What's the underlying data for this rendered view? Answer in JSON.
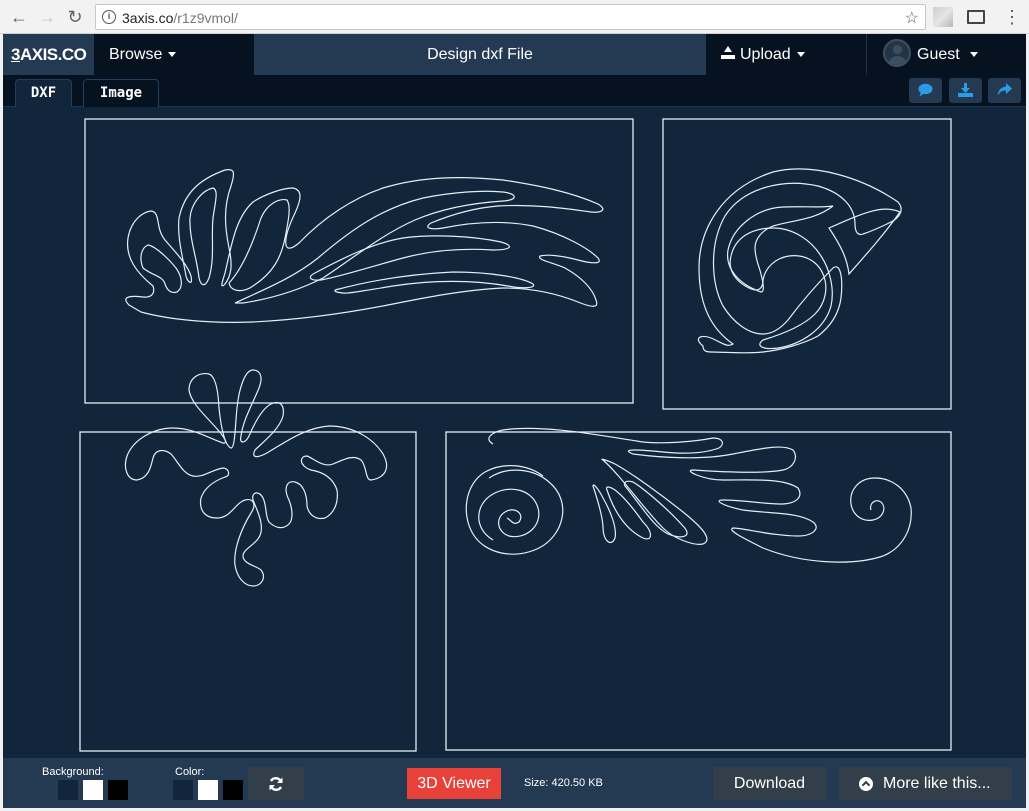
{
  "browser": {
    "url_host": "3axis.co",
    "url_path": "/r1z9vmol/",
    "back_icon": "arrow-left-icon",
    "forward_icon": "arrow-right-icon",
    "reload_icon": "reload-icon"
  },
  "header": {
    "brand": "3AXIS.CO",
    "browse_label": "Browse",
    "title": "Design dxf File",
    "upload_label": "Upload",
    "user_label": "Guest"
  },
  "tabs": [
    {
      "label": "DXF",
      "active": true
    },
    {
      "label": "Image",
      "active": false
    }
  ],
  "actions": [
    {
      "name": "comment",
      "icon": "comment-icon"
    },
    {
      "name": "download",
      "icon": "download-icon"
    },
    {
      "name": "share",
      "icon": "share-icon"
    }
  ],
  "colors": {
    "accent_blue": "#2b9be8",
    "viewer_red": "#e8413a",
    "canvas_bg": "#11263b",
    "stroke": "#e6eef5"
  },
  "bottom": {
    "background_label": "Background:",
    "background_swatches": [
      "#11263b",
      "#ffffff",
      "#000000"
    ],
    "color_label": "Color:",
    "color_swatches": [
      "#11263b",
      "#ffffff",
      "#000000"
    ],
    "viewer_label": "3D Viewer",
    "size_text": "Size: 420.50 KB",
    "download_label": "Download",
    "more_label": "More like this..."
  }
}
